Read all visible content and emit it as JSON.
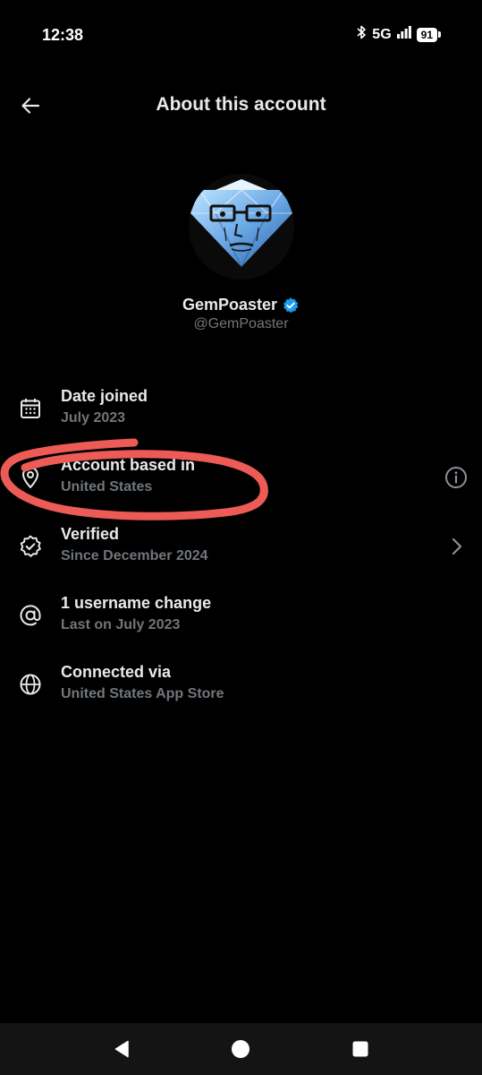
{
  "status_bar": {
    "time": "12:38",
    "network": "5G",
    "battery": "91"
  },
  "header": {
    "title": "About this account",
    "back_icon": "arrow-left-icon"
  },
  "profile": {
    "display_name": "GemPoaster",
    "handle": "@GemPoaster",
    "verified_color": "#1d9bf0"
  },
  "rows": [
    {
      "icon": "calendar-icon",
      "title": "Date joined",
      "subtitle": "July 2023"
    },
    {
      "icon": "location-pin-icon",
      "title": "Account based in",
      "subtitle": "United States",
      "action_icon": "info-icon"
    },
    {
      "icon": "verified-badge-icon",
      "title": "Verified",
      "subtitle": "Since December 2024",
      "action_icon": "chevron-right-icon"
    },
    {
      "icon": "at-sign-icon",
      "title": "1 username change",
      "subtitle": "Last on July 2023"
    },
    {
      "icon": "globe-icon",
      "title": "Connected via",
      "subtitle": "United States App Store"
    }
  ],
  "colors": {
    "background": "#000000",
    "primary_text": "#e7e9ea",
    "secondary_text": "#71767b",
    "annotation": "#ec5b55",
    "nav_bar": "#141414"
  }
}
